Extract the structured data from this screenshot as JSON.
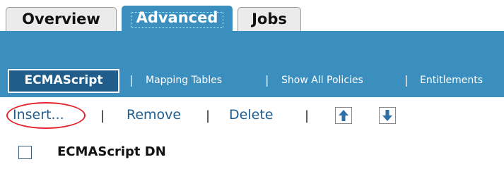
{
  "tabs": [
    {
      "label": "Overview",
      "active": false
    },
    {
      "label": "Advanced",
      "active": true
    },
    {
      "label": "Jobs",
      "active": false
    }
  ],
  "subnav": {
    "active": "ECMAScript",
    "items": [
      "Mapping Tables",
      "Show All Policies",
      "Entitlements"
    ],
    "separator": "|"
  },
  "actions": {
    "insert": "Insert...",
    "remove": "Remove",
    "delete": "Delete",
    "separator": "|",
    "move_up_icon": "arrow-up-icon",
    "move_down_icon": "arrow-down-icon"
  },
  "table": {
    "column_header": "ECMAScript DN"
  },
  "colors": {
    "accent": "#3a8fbf",
    "active_subtab": "#205d8a",
    "link": "#1f5d8f",
    "highlight": "#e0252f"
  }
}
